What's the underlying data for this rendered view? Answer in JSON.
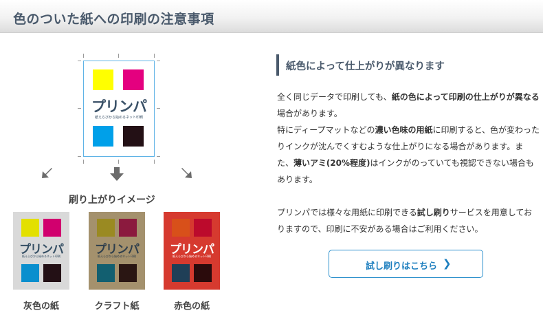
{
  "header": {
    "title": "色のついた紙への印刷の注意事項"
  },
  "illustration": {
    "logo_text": "プリンパ",
    "tagline": "紙えらびから始めるネット印刷",
    "caption": "刷り上がりイメージ",
    "colors": {
      "yellow": "#ffff00",
      "magenta": "#e4007f",
      "cyan": "#00a0e9",
      "black": "#231015"
    },
    "papers": [
      {
        "label": "灰色の紙",
        "bg": "#d9d9d9",
        "c1": "#e3e000",
        "c2": "#d1006e",
        "c3": "#0a8fce",
        "c4": "#231015",
        "logo": "#344e63"
      },
      {
        "label": "クラフト紙",
        "bg": "#a4916d",
        "c1": "#9a8a22",
        "c2": "#8b1a3e",
        "c3": "#125f70",
        "c4": "#2a1613",
        "logo": "#2e3e4c"
      },
      {
        "label": "赤色の紙",
        "bg": "#d63a2f",
        "c1": "#d8501a",
        "c2": "#bc0a2c",
        "c3": "#1f3f57",
        "c4": "#2b0b0c",
        "logo": "#ffffff"
      }
    ]
  },
  "section": {
    "subheading": "紙色によって仕上がりが異なります",
    "p1": {
      "a": "全く同じデータで印刷しても、",
      "b": "紙の色によって印刷の仕上がりが異なる",
      "c": "場合があります。"
    },
    "p2": {
      "a": "特にディープマットなどの",
      "b": "濃い色味の用紙",
      "c": "に印刷すると、色が変わったりインクが沈んでくすむような仕上がりになる場合があります。また、",
      "d": "薄いアミ(20%程度)",
      "e": "はインクがのっていても視認できない場合もあります。"
    },
    "p3": {
      "a": "プリンパでは様々な用紙に印刷できる",
      "b": "試し刷り",
      "c": "サービスを用意しておりますので、印刷に不安がある場合はご利用ください。"
    },
    "button_label": "試し刷りはこちら",
    "button_chevron": "❯",
    "accent": "#4a5a6c",
    "link_color": "#1e7fbf"
  }
}
